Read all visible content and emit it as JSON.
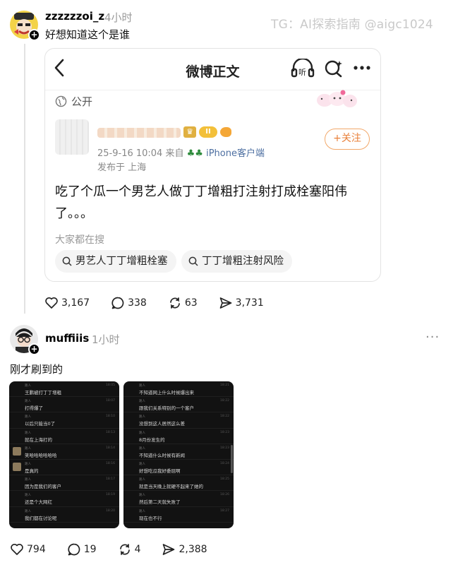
{
  "watermark": "TG：AI探索指南 @aigc1024",
  "post1": {
    "username": "zzzzzzoi_z",
    "time": "4小时",
    "text": "好想知道这个是谁",
    "embed": {
      "title": "微博正文",
      "listen_label": "听",
      "visibility": "公开",
      "author_level": "II",
      "meta_time": "25-9-16 10:04",
      "meta_from": "来自",
      "meta_device": "iPhone客户端",
      "meta_location": "发布于 上海",
      "follow_label": "+关注",
      "body": "吃了个瓜一个男艺人做丁丁增粗打注射打成栓塞阳伟了。。。",
      "search_label": "大家都在搜",
      "chips": [
        "男艺人丁丁增粗栓塞",
        "丁丁增粗注射风险"
      ]
    },
    "likes": "3,167",
    "comments": "338",
    "reposts": "63",
    "shares": "3,731"
  },
  "post2": {
    "username": "muffiiis",
    "time": "1小时",
    "more": "···",
    "text": "刚才刷到的",
    "screenshot_left": [
      {
        "user": "路人",
        "msg": "王鹏被打丁丁增粗",
        "time": "18:05"
      },
      {
        "user": "路人",
        "msg": "打得爆了",
        "time": "18:07"
      },
      {
        "user": "路人",
        "msg": "以后只能当0了",
        "time": "18:10"
      },
      {
        "user": "路人",
        "msg": "就在上海打的",
        "time": "18:13"
      },
      {
        "user": "路人",
        "msg": "笑哈哈哈哈哈哈",
        "time": "18:14"
      },
      {
        "user": "路人",
        "msg": "是真的",
        "time": "18:16"
      },
      {
        "user": "路人",
        "msg": "因为是我们的客户",
        "time": "18:17"
      },
      {
        "user": "路人",
        "msg": "还是个大网红",
        "time": "18:19"
      },
      {
        "user": "路人",
        "msg": "我们都在讨论呢",
        "time": "18:20"
      }
    ],
    "screenshot_right": [
      {
        "user": "路人",
        "msg": "不知道网上什么时候爆出来",
        "time": "18:21"
      },
      {
        "user": "路人",
        "msg": "跟我们关系特别的一个客户",
        "time": "18:22"
      },
      {
        "user": "路人",
        "msg": "没想到这人居然这么差",
        "time": "18:22"
      },
      {
        "user": "路人",
        "msg": "8月份发生的",
        "time": "18:23"
      },
      {
        "user": "路人",
        "msg": "不知道什么时候有新闻",
        "time": "18:23"
      },
      {
        "user": "路人",
        "msg": "好想吃瓜我好委屈啊",
        "time": "18:24"
      },
      {
        "user": "路人",
        "msg": "就是当天晚上就硬不起来了她的",
        "time": "18:25"
      },
      {
        "user": "路人",
        "msg": "然后第二天就失败了",
        "time": "18:26"
      },
      {
        "user": "路人",
        "msg": "现在也不行",
        "time": "18:27"
      }
    ],
    "likes": "794",
    "comments": "19",
    "reposts": "4",
    "shares": "2,388"
  },
  "colors": {
    "follow_orange": "#e9803a",
    "screenshot_bg": "#121212",
    "muted_gray": "#9a9a9a"
  }
}
